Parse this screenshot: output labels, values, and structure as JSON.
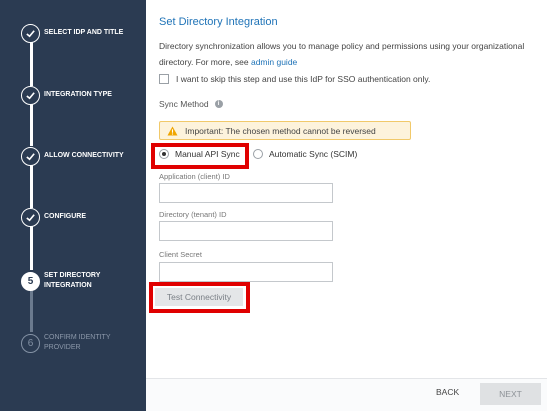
{
  "sidebar": {
    "steps": [
      {
        "label": "SELECT IDP AND TITLE",
        "state": "done"
      },
      {
        "label": "INTEGRATION TYPE",
        "state": "done"
      },
      {
        "label": "ALLOW CONNECTIVITY",
        "state": "done"
      },
      {
        "label": "CONFIGURE",
        "state": "done"
      },
      {
        "label": "SET DIRECTORY INTEGRATION",
        "state": "current",
        "number": "5"
      },
      {
        "label": "CONFIRM IDENTITY PROVIDER",
        "state": "future",
        "number": "6"
      }
    ]
  },
  "main": {
    "title": "Set Directory Integration",
    "description": "Directory synchronization allows you to manage policy and permissions using your organizational directory. For more, see",
    "description_link": "admin guide",
    "skip_checkbox_label": "I want to skip this step and use this IdP for SSO authentication only.",
    "sync_method_label": "Sync Method",
    "warning_text": "Important: The chosen method cannot be reversed",
    "radio_manual": "Manual API Sync",
    "radio_auto": "Automatic Sync (SCIM)",
    "field_app_id_label": "Application (client) ID",
    "field_tenant_id_label": "Directory (tenant) ID",
    "field_secret_label": "Client Secret",
    "test_button": "Test Connectivity"
  },
  "footer": {
    "back": "BACK",
    "next": "NEXT"
  },
  "colors": {
    "sidebar_bg": "#2b3b52",
    "accent": "#1f73b7",
    "highlight": "#e00000"
  }
}
